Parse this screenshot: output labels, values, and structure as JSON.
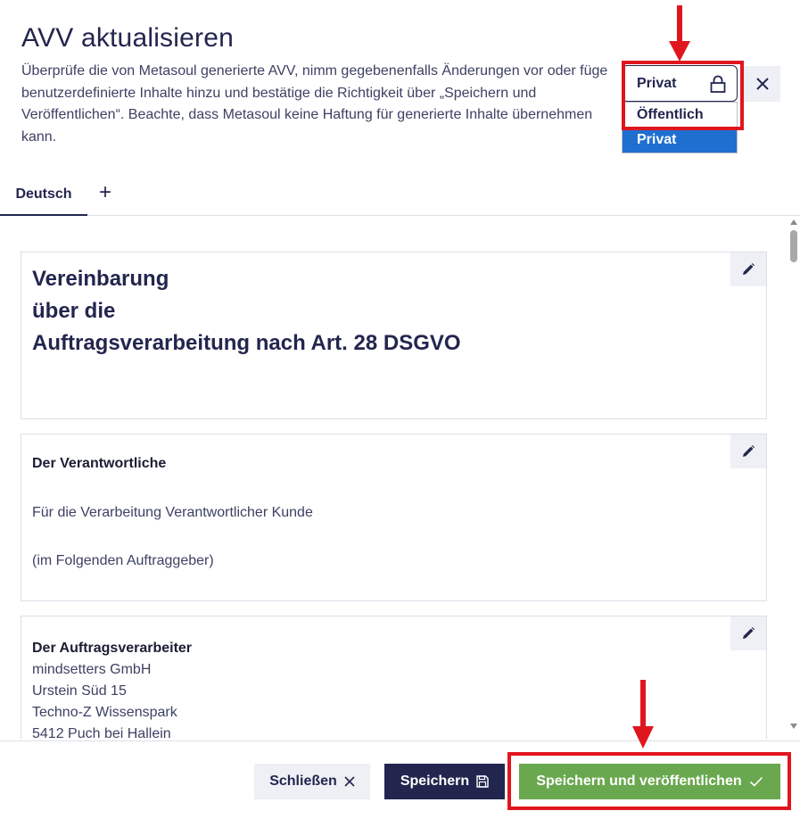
{
  "header": {
    "title": "AVV aktualisieren",
    "description": "Überprüfe die von Metasoul generierte AVV, nimm gegebenenfalls Änderungen vor oder füge benutzerdefinierte Inhalte hinzu und bestätige die Richtigkeit über „Speichern und Veröffentlichen“. Beachte, dass Metasoul keine Haftung für generierte Inhalte übernehmen kann."
  },
  "visibility": {
    "selected_label": "Privat",
    "options": [
      {
        "label": "Öffentlich",
        "selected": false
      },
      {
        "label": "Privat",
        "selected": true
      }
    ]
  },
  "tabs": [
    {
      "label": "Deutsch",
      "active": true
    }
  ],
  "tab_add_label": "+",
  "cards": {
    "c1": {
      "line1": "Vereinbarung",
      "line2": "über die",
      "line3": "Auftragsverarbeitung nach Art. 28 DSGVO"
    },
    "c2": {
      "heading": "Der Verantwortliche",
      "line1": "Für die Verarbeitung Verantwortlicher Kunde",
      "line2": "(im Folgenden Auftraggeber)"
    },
    "c3": {
      "heading": "Der Auftragsverarbeiter",
      "line1": "mindsetters GmbH",
      "line2": "Urstein Süd 15",
      "line3": "Techno-Z Wissenspark",
      "line4": "5412 Puch bei Hallein"
    }
  },
  "footer": {
    "close_label": "Schließen",
    "save_label": "Speichern",
    "publish_label": "Speichern und veröffentlichen"
  },
  "colors": {
    "primary": "#22264e",
    "success": "#6aa84f",
    "selected_option": "#1f6fd1",
    "annotation": "#e0161e"
  },
  "icons": {
    "lock": "lock-icon",
    "close": "close-icon",
    "edit": "pencil-icon",
    "save": "floppy-disk-icon",
    "check": "check-icon",
    "add": "plus-icon"
  }
}
